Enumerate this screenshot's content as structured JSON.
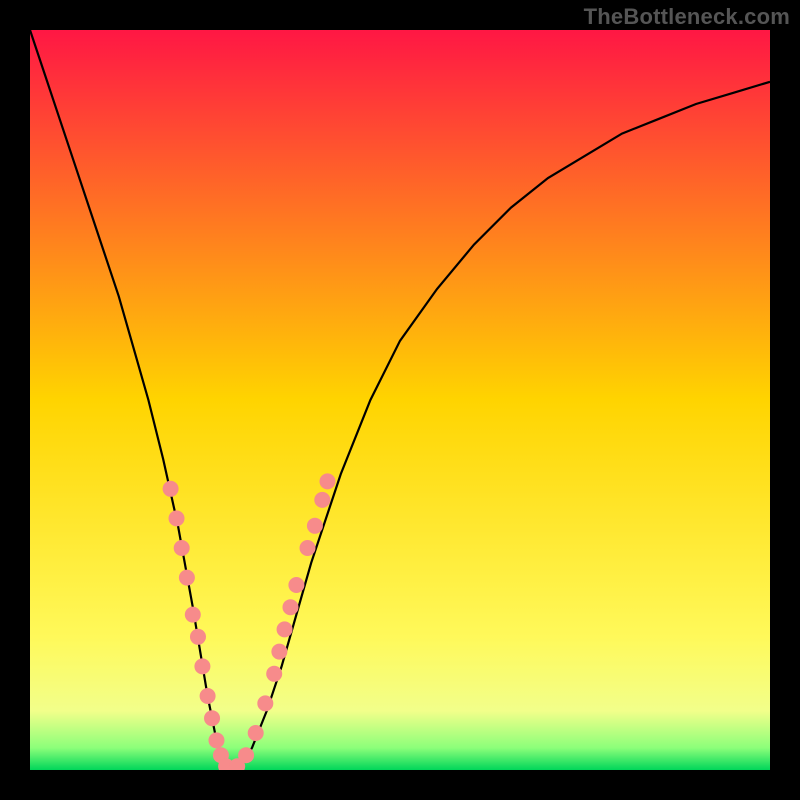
{
  "attribution": "TheBottleneck.com",
  "chart_data": {
    "type": "line",
    "title": "",
    "xlabel": "",
    "ylabel": "",
    "xlim": [
      0,
      100
    ],
    "ylim": [
      0,
      100
    ],
    "grid": false,
    "legend": {
      "position": "none"
    },
    "gradient_stops": [
      {
        "offset": 0.0,
        "color": "#ff1744"
      },
      {
        "offset": 0.5,
        "color": "#ffd400"
      },
      {
        "offset": 0.82,
        "color": "#fff95a"
      },
      {
        "offset": 0.92,
        "color": "#f2ff8a"
      },
      {
        "offset": 0.97,
        "color": "#8cff7a"
      },
      {
        "offset": 1.0,
        "color": "#00d65a"
      }
    ],
    "series": [
      {
        "name": "curve",
        "color": "#000000",
        "x": [
          0,
          2,
          4,
          6,
          8,
          10,
          12,
          14,
          16,
          18,
          20,
          22,
          23,
          24,
          25,
          26,
          27,
          28,
          30,
          32,
          34,
          36,
          38,
          42,
          46,
          50,
          55,
          60,
          65,
          70,
          75,
          80,
          85,
          90,
          95,
          100
        ],
        "y": [
          100,
          94,
          88,
          82,
          76,
          70,
          64,
          57,
          50,
          42,
          33,
          22,
          16,
          10,
          5,
          1,
          0,
          0,
          3,
          8,
          14,
          21,
          28,
          40,
          50,
          58,
          65,
          71,
          76,
          80,
          83,
          86,
          88,
          90,
          91.5,
          93
        ]
      }
    ],
    "marker_points": {
      "name": "bottleneck-markers",
      "color": "#f78b8b",
      "radius_px": 8,
      "points": [
        {
          "x": 19.0,
          "y": 38.0
        },
        {
          "x": 19.8,
          "y": 34.0
        },
        {
          "x": 20.5,
          "y": 30.0
        },
        {
          "x": 21.2,
          "y": 26.0
        },
        {
          "x": 22.0,
          "y": 21.0
        },
        {
          "x": 22.7,
          "y": 18.0
        },
        {
          "x": 23.3,
          "y": 14.0
        },
        {
          "x": 24.0,
          "y": 10.0
        },
        {
          "x": 24.6,
          "y": 7.0
        },
        {
          "x": 25.2,
          "y": 4.0
        },
        {
          "x": 25.8,
          "y": 2.0
        },
        {
          "x": 26.5,
          "y": 0.5
        },
        {
          "x": 28.0,
          "y": 0.5
        },
        {
          "x": 29.2,
          "y": 2.0
        },
        {
          "x": 30.5,
          "y": 5.0
        },
        {
          "x": 31.8,
          "y": 9.0
        },
        {
          "x": 33.0,
          "y": 13.0
        },
        {
          "x": 33.7,
          "y": 16.0
        },
        {
          "x": 34.4,
          "y": 19.0
        },
        {
          "x": 35.2,
          "y": 22.0
        },
        {
          "x": 36.0,
          "y": 25.0
        },
        {
          "x": 37.5,
          "y": 30.0
        },
        {
          "x": 38.5,
          "y": 33.0
        },
        {
          "x": 39.5,
          "y": 36.5
        },
        {
          "x": 40.2,
          "y": 39.0
        }
      ]
    },
    "annotations": []
  }
}
